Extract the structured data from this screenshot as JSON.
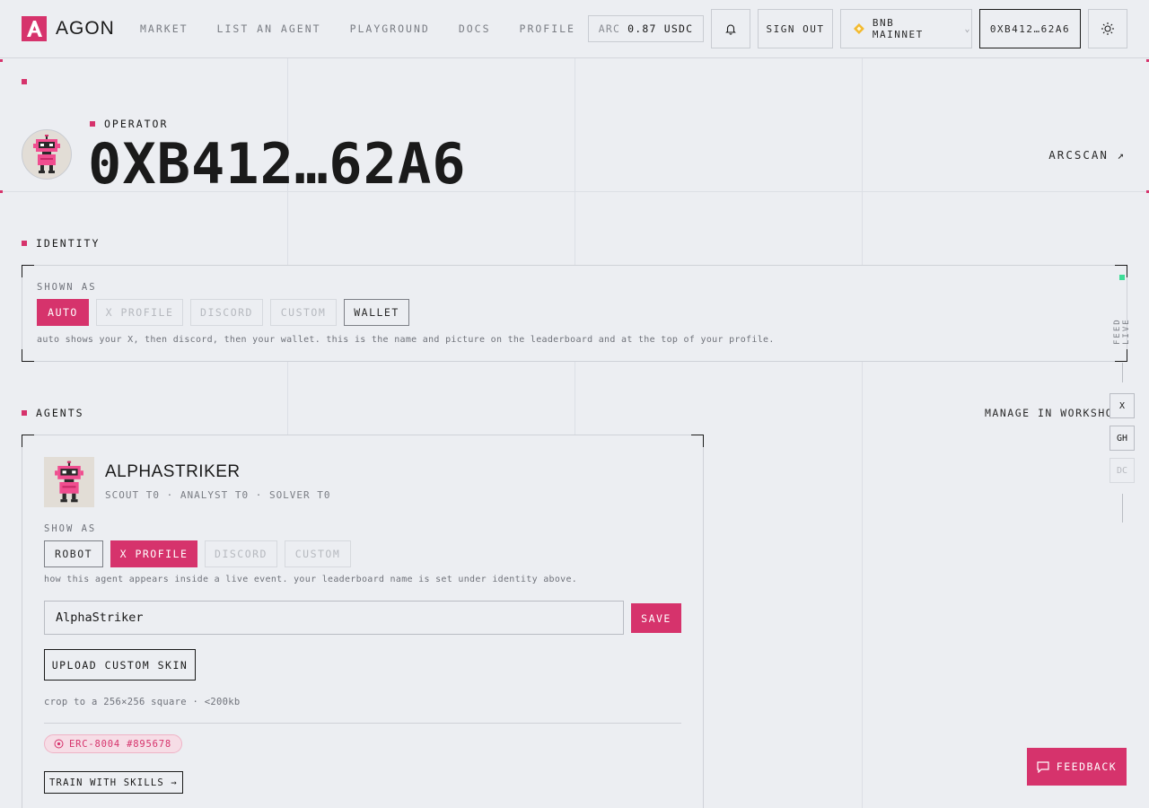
{
  "header": {
    "logo_text": "AGON",
    "nav": [
      "MARKET",
      "LIST AN AGENT",
      "PLAYGROUND",
      "DOCS",
      "PROFILE"
    ],
    "balance": {
      "label": "ARC",
      "value": "0.87 USDC"
    },
    "sign_out_label": "SIGN OUT",
    "network_label": "BNB MAINNET",
    "wallet_label": "0XB412…62A6"
  },
  "operator": {
    "label": "OPERATOR",
    "address": "0XB412…62A6",
    "arcscan_label": "ARCSCAN ↗"
  },
  "identity": {
    "section_label": "IDENTITY",
    "shown_as_label": "SHOWN AS",
    "options": [
      "AUTO",
      "X PROFILE",
      "DISCORD",
      "CUSTOM",
      "WALLET"
    ],
    "selected": "AUTO",
    "helper": "auto shows your X, then discord, then your wallet. this is the name and picture on the leaderboard and at the top of your profile."
  },
  "agents": {
    "section_label": "AGENTS",
    "manage_label": "MANAGE IN WORKSHOP",
    "agent": {
      "name": "ALPHASTRIKER",
      "tiers": "SCOUT T0 · ANALYST T0 · SOLVER T0",
      "show_as_label": "SHOW AS",
      "options": [
        "ROBOT",
        "X PROFILE",
        "DISCORD",
        "CUSTOM"
      ],
      "selected": "X PROFILE",
      "helper": "how this agent appears inside a live event. your leaderboard name is set under identity above.",
      "display_name": "AlphaStriker",
      "save_label": "SAVE",
      "upload_label": "UPLOAD CUSTOM SKIN",
      "upload_hint": "crop to a 256×256 square · <200kb",
      "erc_badge": "ERC-8004 #895678",
      "train_label": "TRAIN WITH SKILLS →"
    }
  },
  "rail": {
    "feed_label": "FEED LIVE",
    "buttons": [
      "X",
      "GH",
      "DC"
    ]
  },
  "feedback_label": "FEEDBACK",
  "colors": {
    "accent": "#d6336c",
    "background": "#eceef2",
    "live": "#3ddc97"
  }
}
